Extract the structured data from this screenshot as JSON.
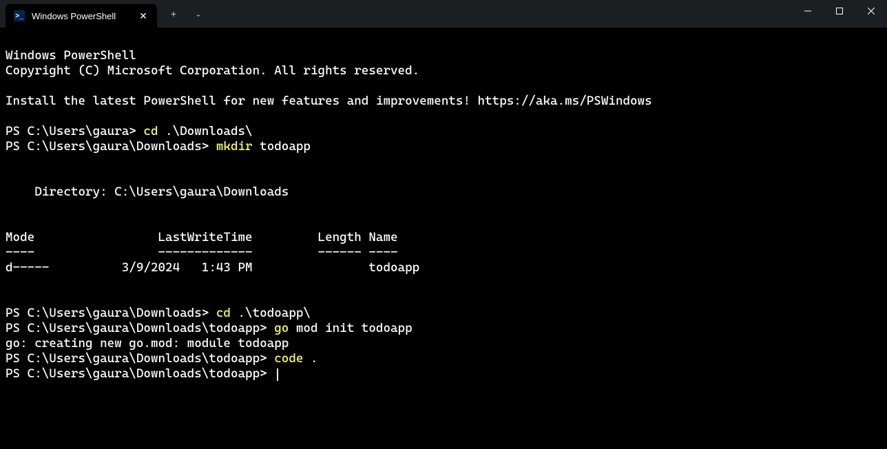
{
  "titlebar": {
    "tab_title": "Windows PowerShell",
    "tab_icon_text": ">_"
  },
  "terminal": {
    "header1": "Windows PowerShell",
    "header2": "Copyright (C) Microsoft Corporation. All rights reserved.",
    "install_msg": "Install the latest PowerShell for new features and improvements! https://aka.ms/PSWindows",
    "prompt1": "PS C:\\Users\\gaura> ",
    "cmd1_a": "cd",
    "cmd1_b": " .\\Downloads\\",
    "prompt2": "PS C:\\Users\\gaura\\Downloads> ",
    "cmd2_a": "mkdir",
    "cmd2_b": " todoapp",
    "dir_label": "    Directory: C:\\Users\\gaura\\Downloads",
    "table_header": "Mode                 LastWriteTime         Length Name",
    "table_sep": "----                 -------------         ------ ----",
    "table_row": "d-----          3/9/2024   1:43 PM                todoapp",
    "prompt3": "PS C:\\Users\\gaura\\Downloads> ",
    "cmd3_a": "cd",
    "cmd3_b": " .\\todoapp\\",
    "prompt4": "PS C:\\Users\\gaura\\Downloads\\todoapp> ",
    "cmd4_a": "go",
    "cmd4_b": " mod init todoapp",
    "go_output": "go: creating new go.mod: module todoapp",
    "prompt5": "PS C:\\Users\\gaura\\Downloads\\todoapp> ",
    "cmd5_a": "code",
    "cmd5_b": " .",
    "prompt6": "PS C:\\Users\\gaura\\Downloads\\todoapp> "
  }
}
